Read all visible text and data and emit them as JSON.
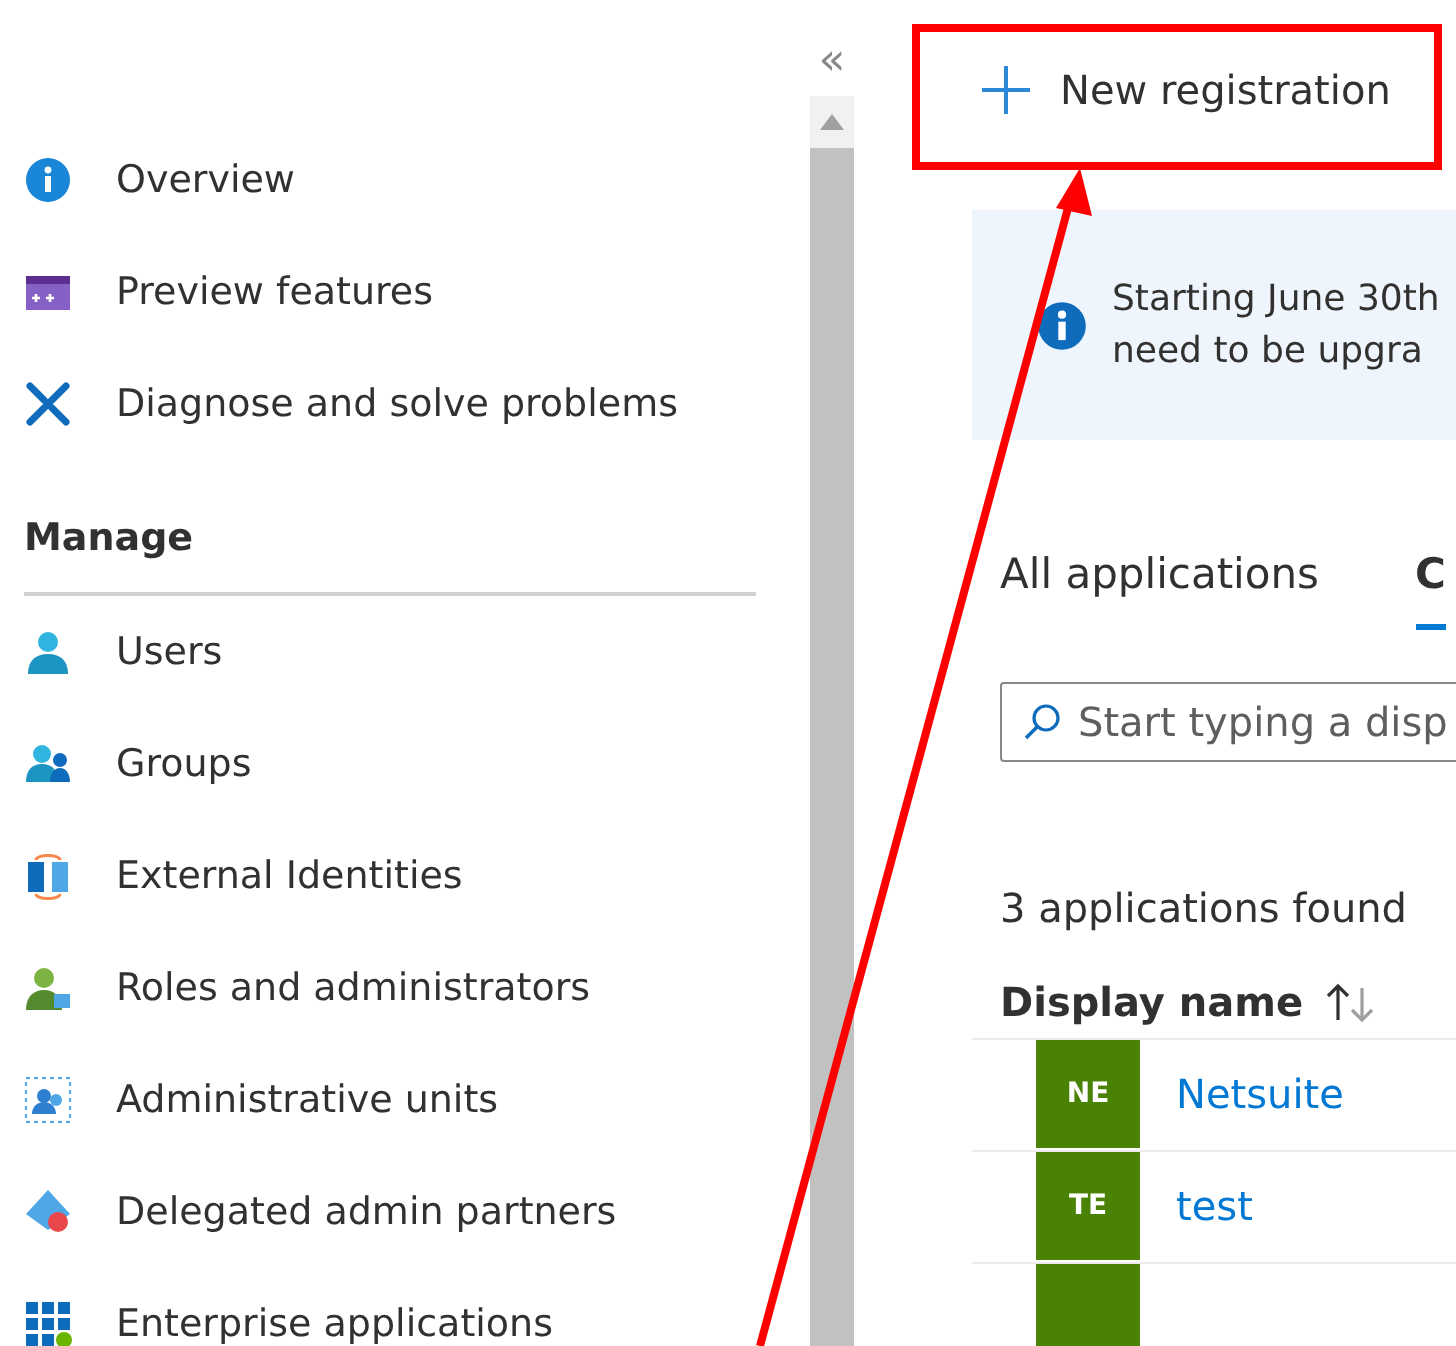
{
  "sidebar": {
    "items": [
      {
        "label": "Overview"
      },
      {
        "label": "Preview features"
      },
      {
        "label": "Diagnose and solve problems"
      }
    ],
    "section": {
      "title": "Manage",
      "items": [
        {
          "label": "Users"
        },
        {
          "label": "Groups"
        },
        {
          "label": "External Identities"
        },
        {
          "label": "Roles and administrators"
        },
        {
          "label": "Administrative units"
        },
        {
          "label": "Delegated admin partners"
        },
        {
          "label": "Enterprise applications"
        }
      ]
    }
  },
  "collapse": "«",
  "toolbar": {
    "button": "New registration"
  },
  "banner": {
    "lines": [
      "Starting June 30th",
      "need to be upgra"
    ]
  },
  "tabs": [
    {
      "label": "All applications",
      "selected": false
    },
    {
      "label": "C",
      "selected": true
    }
  ],
  "search": {
    "placeholder": "Start typing a disp"
  },
  "count": "3 applications found",
  "table": {
    "columns": [
      "Display name"
    ],
    "rows": [
      {
        "initials": "NE",
        "name": "Netsuite"
      },
      {
        "initials": "TE",
        "name": "test"
      },
      {
        "initials": "",
        "name": ""
      }
    ]
  }
}
